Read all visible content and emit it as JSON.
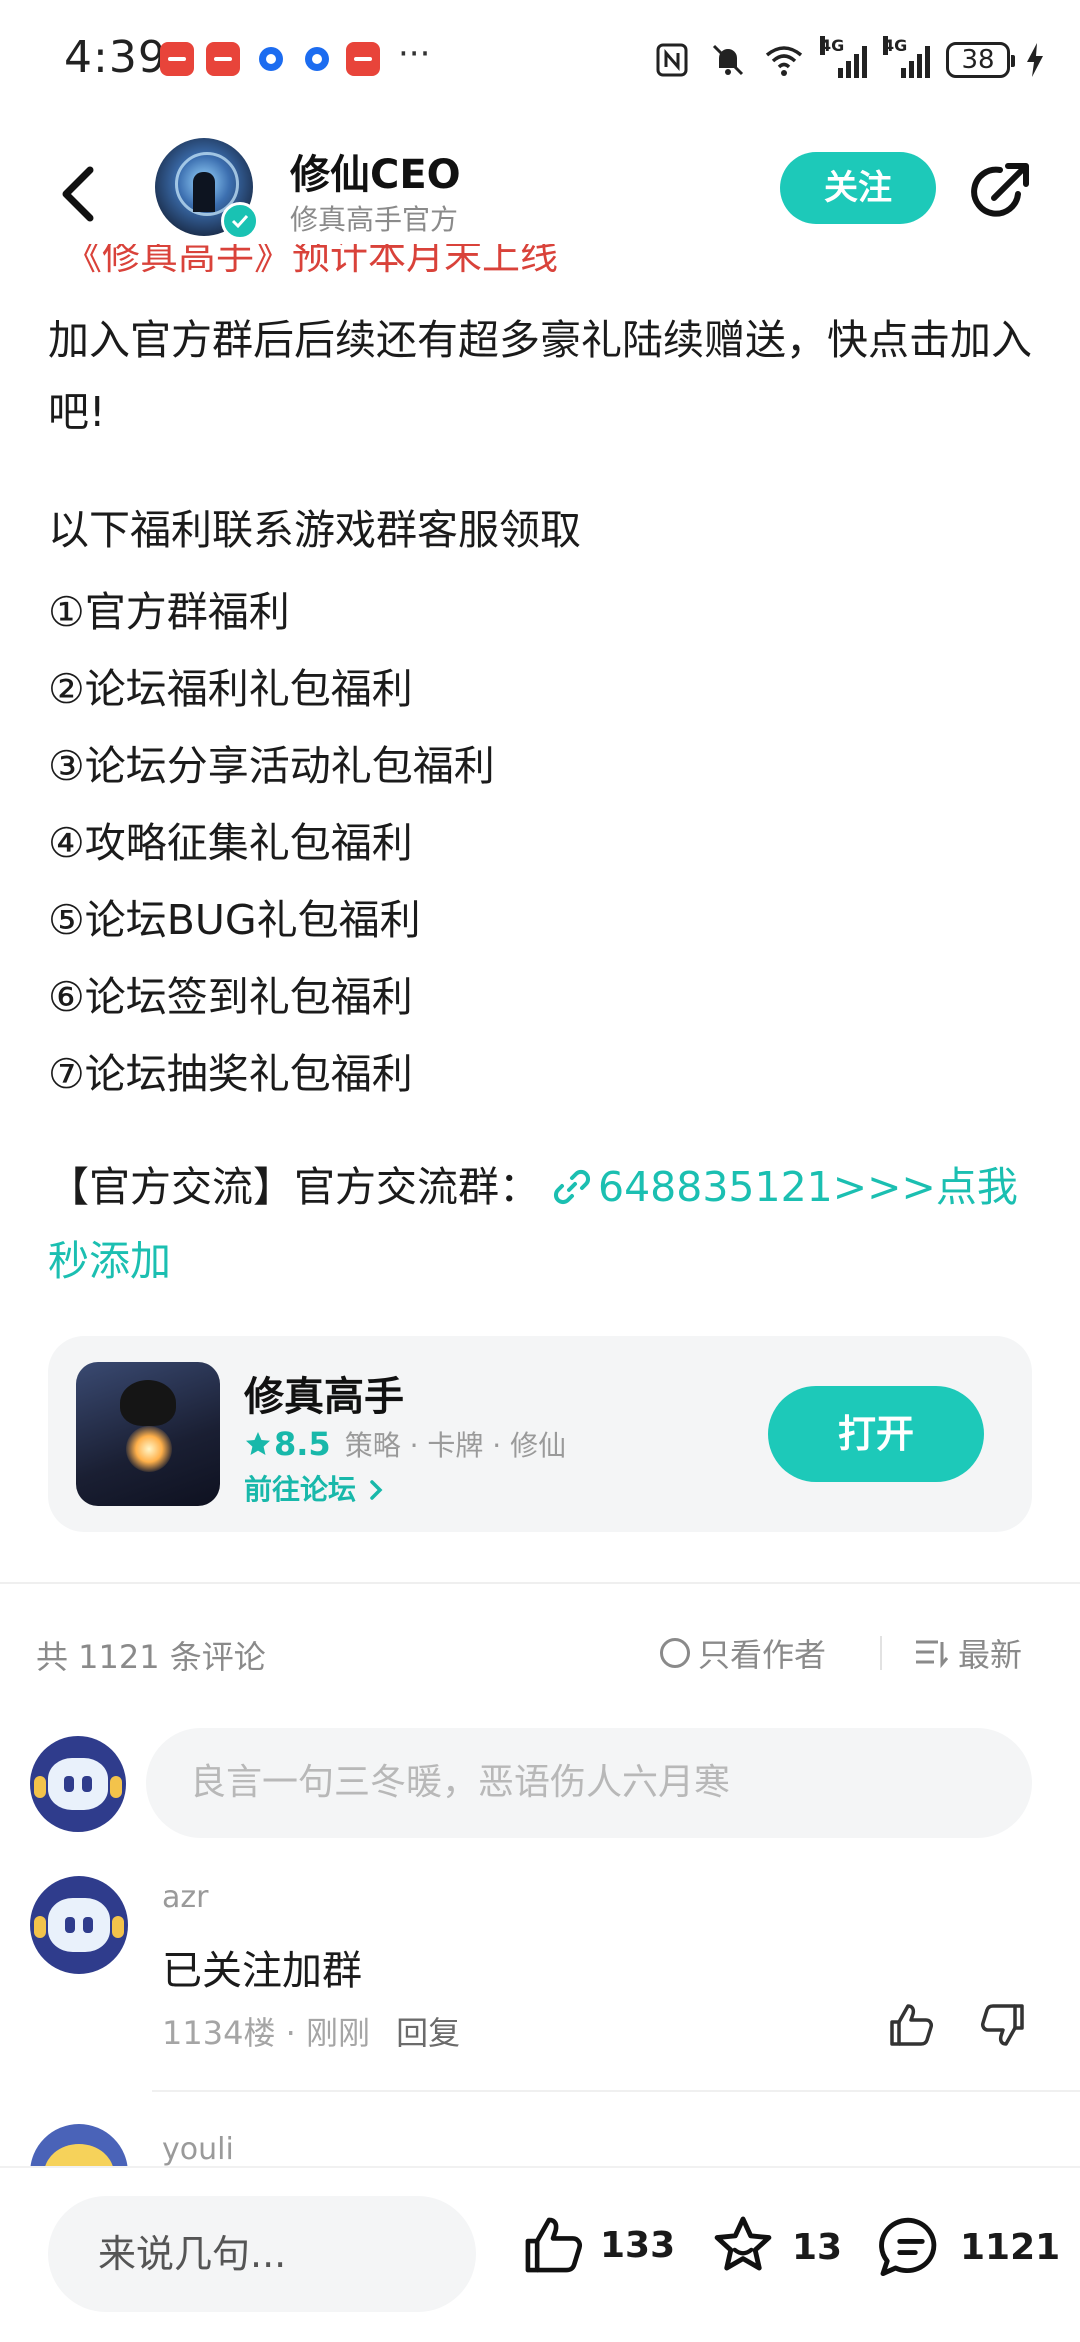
{
  "status_bar": {
    "time": "4:39",
    "more": "···",
    "battery": "38",
    "network_1": "4G",
    "network_2": "4G"
  },
  "header": {
    "author_name": "修仙CEO",
    "author_subtitle": "修真高手官方",
    "follow_label": "关注"
  },
  "article": {
    "cut_off_line": "《修真高手》预计本月末上线",
    "paragraph_1": "加入官方群后后续还有超多豪礼陆续赠送，快点击加入吧!",
    "paragraph_2": "以下福利联系游戏群客服领取",
    "benefits": [
      "①官方群福利",
      "②论坛福利礼包福利",
      "③论坛分享活动礼包福利",
      "④攻略征集礼包福利",
      "⑤论坛BUG礼包福利",
      "⑥论坛签到礼包福利",
      "⑦论坛抽奖礼包福利"
    ],
    "contact_prefix": "【官方交流】官方交流群：",
    "contact_link": "648835121>>>点我秒添加"
  },
  "game_card": {
    "title": "修真高手",
    "rating": "8.5",
    "tags": "策略 · 卡牌 · 修仙",
    "forum_link": "前往论坛",
    "open_label": "打开"
  },
  "comments": {
    "count_label": "共 1121 条评论",
    "author_only_label": "只看作者",
    "sort_label": "最新",
    "input_placeholder": "良言一句三冬暖，恶语伤人六月寒",
    "items": [
      {
        "user": "azr",
        "text": "已关注加群",
        "floor": "1134楼",
        "time": "刚刚",
        "reply_label": "回复"
      },
      {
        "user": "youli"
      }
    ]
  },
  "bottom_bar": {
    "input_placeholder": "来说几句...",
    "likes": "133",
    "favorites": "13",
    "comments": "1121"
  },
  "colors": {
    "accent": "#1dc9b9",
    "link": "#1bbfb1",
    "warning_red": "#d9423a"
  }
}
